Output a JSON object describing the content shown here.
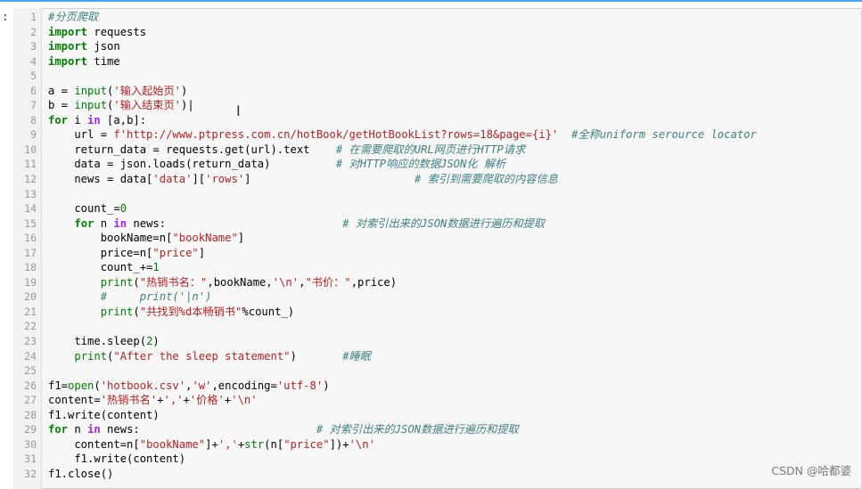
{
  "cell": {
    "prompt": ":",
    "lines": [
      [
        {
          "c": "cm",
          "t": "#分页爬取"
        }
      ],
      [
        {
          "c": "kw",
          "t": "import"
        },
        {
          "c": "",
          "t": " requests"
        }
      ],
      [
        {
          "c": "kw",
          "t": "import"
        },
        {
          "c": "",
          "t": " json"
        }
      ],
      [
        {
          "c": "kw",
          "t": "import"
        },
        {
          "c": "",
          "t": " time"
        }
      ],
      [],
      [
        {
          "c": "",
          "t": "a = "
        },
        {
          "c": "bi",
          "t": "input"
        },
        {
          "c": "",
          "t": "("
        },
        {
          "c": "str",
          "t": "'输入起始页'"
        },
        {
          "c": "",
          "t": ")"
        }
      ],
      [
        {
          "c": "",
          "t": "b = "
        },
        {
          "c": "bi",
          "t": "input"
        },
        {
          "c": "",
          "t": "("
        },
        {
          "c": "str",
          "t": "'输入结束页'"
        },
        {
          "c": "",
          "t": ")|"
        }
      ],
      [
        {
          "c": "kw",
          "t": "for"
        },
        {
          "c": "",
          "t": " i "
        },
        {
          "c": "op",
          "t": "in"
        },
        {
          "c": "",
          "t": " [a,b]:"
        }
      ],
      [
        {
          "c": "",
          "t": "    url = "
        },
        {
          "c": "str",
          "t": "f'http://www.ptpress.com.cn/hotBook/getHotBookList?rows=18&page={i}'"
        },
        {
          "c": "",
          "t": "  "
        },
        {
          "c": "cm",
          "t": "#全称uniform serource locator"
        }
      ],
      [
        {
          "c": "",
          "t": "    return_data = requests.get(url).text    "
        },
        {
          "c": "cm",
          "t": "# 在需要爬取的URL网页进行HTTP请求"
        }
      ],
      [
        {
          "c": "",
          "t": "    data = json.loads(return_data)          "
        },
        {
          "c": "cm",
          "t": "# 对HTTP响应的数据JSON化 解析"
        }
      ],
      [
        {
          "c": "",
          "t": "    news = data["
        },
        {
          "c": "str",
          "t": "'data'"
        },
        {
          "c": "",
          "t": "]["
        },
        {
          "c": "str",
          "t": "'rows'"
        },
        {
          "c": "",
          "t": "]                         "
        },
        {
          "c": "cm",
          "t": "# 索引到需要爬取的内容信息"
        }
      ],
      [],
      [
        {
          "c": "",
          "t": "    count_="
        },
        {
          "c": "num",
          "t": "0"
        }
      ],
      [
        {
          "c": "",
          "t": "    "
        },
        {
          "c": "kw",
          "t": "for"
        },
        {
          "c": "",
          "t": " n "
        },
        {
          "c": "op",
          "t": "in"
        },
        {
          "c": "",
          "t": " news:                           "
        },
        {
          "c": "cm",
          "t": "# 对索引出来的JSON数据进行遍历和提取"
        }
      ],
      [
        {
          "c": "",
          "t": "        bookName=n["
        },
        {
          "c": "str",
          "t": "\"bookName\""
        },
        {
          "c": "",
          "t": "]"
        }
      ],
      [
        {
          "c": "",
          "t": "        price=n["
        },
        {
          "c": "str",
          "t": "\"price\""
        },
        {
          "c": "",
          "t": "]"
        }
      ],
      [
        {
          "c": "",
          "t": "        count_+="
        },
        {
          "c": "num",
          "t": "1"
        }
      ],
      [
        {
          "c": "",
          "t": "        "
        },
        {
          "c": "bi",
          "t": "print"
        },
        {
          "c": "",
          "t": "("
        },
        {
          "c": "str",
          "t": "\"热销书名：\""
        },
        {
          "c": "",
          "t": ",bookName,"
        },
        {
          "c": "str",
          "t": "'\\n'"
        },
        {
          "c": "",
          "t": ","
        },
        {
          "c": "str",
          "t": "\"书价：\""
        },
        {
          "c": "",
          "t": ",price)"
        }
      ],
      [
        {
          "c": "",
          "t": "        "
        },
        {
          "c": "cm",
          "t": "#     print('|n')"
        }
      ],
      [
        {
          "c": "",
          "t": "        "
        },
        {
          "c": "bi",
          "t": "print"
        },
        {
          "c": "",
          "t": "("
        },
        {
          "c": "str",
          "t": "\"共找到%d本畅销书\""
        },
        {
          "c": "",
          "t": "%count_)"
        }
      ],
      [],
      [
        {
          "c": "",
          "t": "    time.sleep("
        },
        {
          "c": "num",
          "t": "2"
        },
        {
          "c": "",
          "t": ")"
        }
      ],
      [
        {
          "c": "",
          "t": "    "
        },
        {
          "c": "bi",
          "t": "print"
        },
        {
          "c": "",
          "t": "("
        },
        {
          "c": "str",
          "t": "\"After the sleep statement\""
        },
        {
          "c": "",
          "t": ")       "
        },
        {
          "c": "cm",
          "t": "#睡眠"
        }
      ],
      [],
      [
        {
          "c": "",
          "t": "f1="
        },
        {
          "c": "bi",
          "t": "open"
        },
        {
          "c": "",
          "t": "("
        },
        {
          "c": "str",
          "t": "'hotbook.csv'"
        },
        {
          "c": "",
          "t": ","
        },
        {
          "c": "str",
          "t": "'w'"
        },
        {
          "c": "",
          "t": ",encoding="
        },
        {
          "c": "str",
          "t": "'utf-8'"
        },
        {
          "c": "",
          "t": ")"
        }
      ],
      [
        {
          "c": "",
          "t": "content="
        },
        {
          "c": "str",
          "t": "'热销书名'"
        },
        {
          "c": "",
          "t": "+"
        },
        {
          "c": "str",
          "t": "','"
        },
        {
          "c": "",
          "t": "+"
        },
        {
          "c": "str",
          "t": "'价格'"
        },
        {
          "c": "",
          "t": "+"
        },
        {
          "c": "str",
          "t": "'\\n'"
        }
      ],
      [
        {
          "c": "",
          "t": "f1.write(content)"
        }
      ],
      [
        {
          "c": "kw",
          "t": "for"
        },
        {
          "c": "",
          "t": " n "
        },
        {
          "c": "op",
          "t": "in"
        },
        {
          "c": "",
          "t": " news:                           "
        },
        {
          "c": "cm",
          "t": "# 对索引出来的JSON数据进行遍历和提取"
        }
      ],
      [
        {
          "c": "",
          "t": "    content=n["
        },
        {
          "c": "str",
          "t": "\"bookName\""
        },
        {
          "c": "",
          "t": "]+"
        },
        {
          "c": "str",
          "t": "','"
        },
        {
          "c": "",
          "t": "+"
        },
        {
          "c": "bi",
          "t": "str"
        },
        {
          "c": "",
          "t": "(n["
        },
        {
          "c": "str",
          "t": "\"price\""
        },
        {
          "c": "",
          "t": "])+"
        },
        {
          "c": "str",
          "t": "'\\n'"
        }
      ],
      [
        {
          "c": "",
          "t": "    f1.write(content)"
        }
      ],
      [
        {
          "c": "",
          "t": "f1.close()"
        }
      ]
    ]
  },
  "watermark": "CSDN @哈都婆",
  "cursor_glyph": "I",
  "colors": {
    "keyword": "#008000",
    "string": "#ba2121",
    "comment": "#408080",
    "operator": "#aa22ff"
  }
}
